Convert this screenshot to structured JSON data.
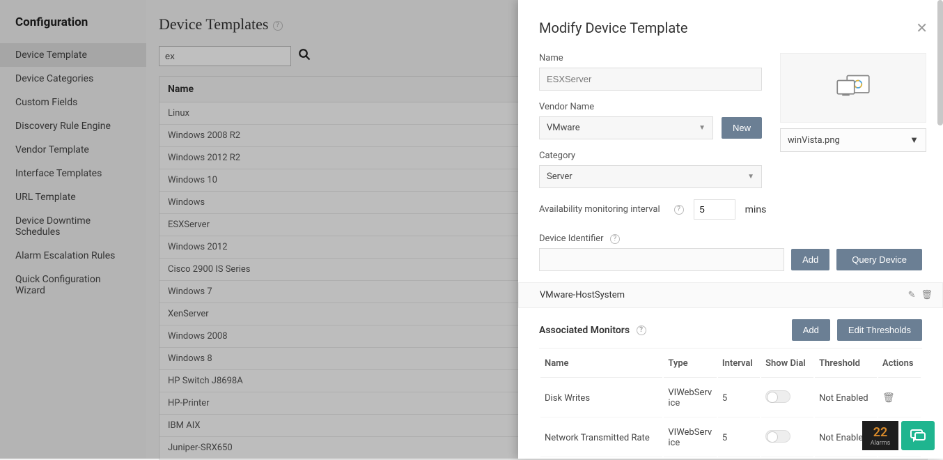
{
  "sidebar": {
    "title": "Configuration",
    "items": [
      {
        "label": "Device Template",
        "active": true
      },
      {
        "label": "Device Categories"
      },
      {
        "label": "Custom Fields"
      },
      {
        "label": "Discovery Rule Engine"
      },
      {
        "label": "Vendor Template"
      },
      {
        "label": "Interface Templates"
      },
      {
        "label": "URL Template"
      },
      {
        "label": "Device Downtime Schedules"
      },
      {
        "label": "Alarm Escalation Rules"
      },
      {
        "label": "Quick Configuration Wizard"
      }
    ]
  },
  "main": {
    "title": "Device Templates",
    "search_value": "ex",
    "table_header": "Name",
    "rows": [
      "Linux",
      "Windows 2008 R2",
      "Windows 2012 R2",
      "Windows 10",
      "Windows",
      "ESXServer",
      "Windows 2012",
      "Cisco 2900 IS Series",
      "Windows 7",
      "XenServer",
      "Windows 2008",
      "Windows 8",
      "HP Switch J8698A",
      "HP-Printer",
      "IBM AIX",
      "Juniper-SRX650"
    ]
  },
  "panel": {
    "title": "Modify Device Template",
    "name_label": "Name",
    "name_value": "ESXServer",
    "vendor_label": "Vendor Name",
    "vendor_value": "VMware",
    "new_btn": "New",
    "category_label": "Category",
    "category_value": "Server",
    "image_name": "winVista.png",
    "avail_label": "Availability monitoring interval",
    "avail_value": "5",
    "avail_unit": "mins",
    "devid_label": "Device Identifier",
    "add_btn": "Add",
    "query_btn": "Query Device",
    "host_value": "VMware-HostSystem",
    "assoc_label": "Associated Monitors",
    "edit_thresh_btn": "Edit Thresholds",
    "mon_headers": {
      "name": "Name",
      "type": "Type",
      "interval": "Interval",
      "dial": "Show Dial",
      "thresh": "Threshold",
      "actions": "Actions"
    },
    "monitors": [
      {
        "name": "Disk Writes",
        "type": "VIWebService",
        "interval": "5",
        "thresh": "Not Enabled"
      },
      {
        "name": "Network Transmitted Rate",
        "type": "VIWebService",
        "interval": "5",
        "thresh": "Not Enabled"
      }
    ]
  },
  "footer": {
    "alarm_count": "22",
    "alarm_label": "Alarms"
  }
}
